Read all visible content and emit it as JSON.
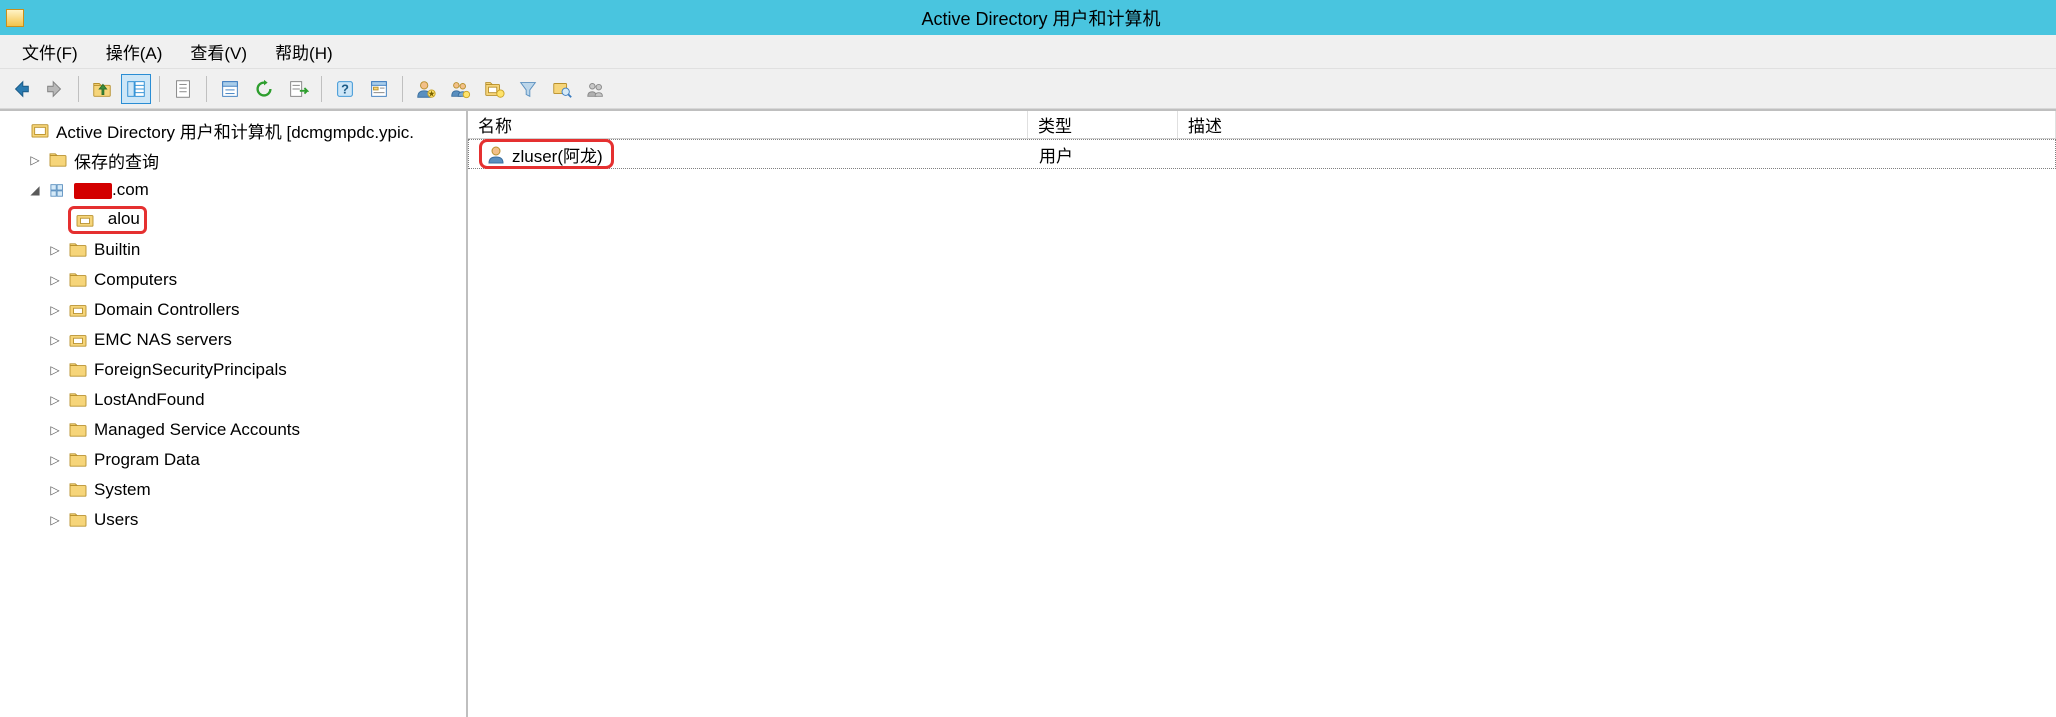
{
  "window": {
    "title": "Active Directory 用户和计算机"
  },
  "menu": {
    "file": "文件(F)",
    "action": "操作(A)",
    "view": "查看(V)",
    "help": "帮助(H)"
  },
  "toolbar_icons": {
    "back": "back-arrow",
    "forward": "forward-arrow",
    "up": "up-folder",
    "show_hide": "show-hide-tree",
    "cut": "properties-list",
    "copy": "properties-sheet",
    "refresh": "refresh",
    "export": "export-list",
    "help": "help",
    "props": "properties",
    "new_user": "new-user",
    "new_group": "new-group",
    "new_ou": "new-ou",
    "filter": "filter",
    "find": "find",
    "add_to_group": "add-to-group"
  },
  "tree": {
    "root": "Active Directory 用户和计算机 [dcmgmpdc.ypic.",
    "saved_queries": "保存的查询",
    "domain_suffix": ".com",
    "ou_alou": "alou",
    "builtin": "Builtin",
    "computers": "Computers",
    "domain_controllers": "Domain Controllers",
    "emc_nas": "EMC NAS servers",
    "fsp": "ForeignSecurityPrincipals",
    "laf": "LostAndFound",
    "msa": "Managed Service Accounts",
    "program_data": "Program Data",
    "system": "System",
    "users": "Users"
  },
  "list": {
    "columns": {
      "name": "名称",
      "type": "类型",
      "desc": "描述"
    },
    "rows": [
      {
        "name": "zluser(阿龙)",
        "type": "用户",
        "desc": ""
      }
    ]
  }
}
